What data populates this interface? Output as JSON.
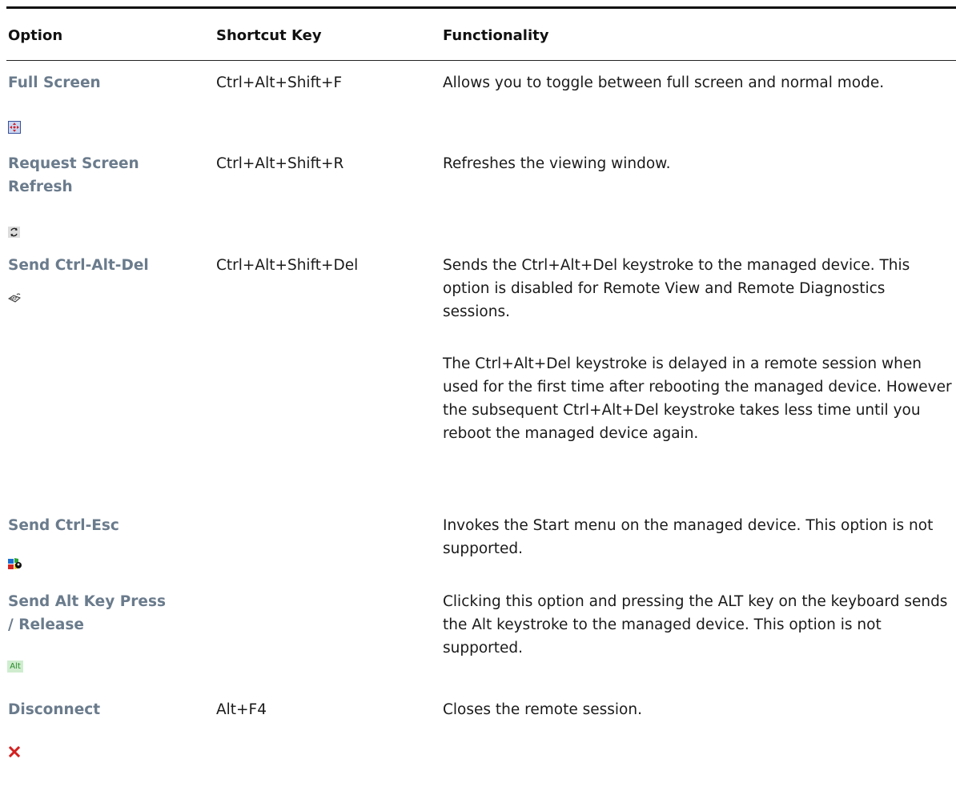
{
  "table": {
    "headers": {
      "option": "Option",
      "shortcut": "Shortcut Key",
      "functionality": "Functionality"
    },
    "rows": [
      {
        "option": "Full Screen",
        "shortcut": "Ctrl+Alt+Shift+F",
        "functionality": [
          "Allows you to toggle between full screen and normal mode."
        ],
        "icon": "full-screen-icon"
      },
      {
        "option": "Request Screen Refresh",
        "shortcut": "Ctrl+Alt+Shift+R",
        "functionality": [
          "Refreshes the viewing window."
        ],
        "icon": "refresh-icon"
      },
      {
        "option": "Send Ctrl-Alt-Del",
        "shortcut": "Ctrl+Alt+Shift+Del",
        "functionality": [
          "Sends the Ctrl+Alt+Del keystroke to the managed device. This option is disabled for Remote View and Remote Diagnostics sessions.",
          "The Ctrl+Alt+Del keystroke is delayed in a remote session when used for the first time after rebooting the managed device. However the subsequent Ctrl+Alt+Del keystroke takes less time until you reboot the managed device again."
        ],
        "icon": "keyboard-icon"
      },
      {
        "option": "Send Ctrl-Esc",
        "shortcut": "",
        "functionality": [
          " Invokes the Start menu on the managed device. This option is not supported."
        ],
        "icon": "windows-flag-icon"
      },
      {
        "option": "Send Alt Key Press / Release",
        "shortcut": "",
        "functionality": [
          "Clicking this option and pressing the ALT key on the keyboard sends the Alt keystroke to the managed device. This option is not supported."
        ],
        "icon": "alt-key-icon",
        "icon_text": "Alt"
      },
      {
        "option": "Disconnect",
        "shortcut": "Alt+F4",
        "functionality": [
          "Closes the remote session."
        ],
        "icon": "close-x-icon"
      }
    ]
  },
  "colors": {
    "option_text": "#6a7b8c",
    "body_text": "#1a1a1a",
    "rule": "#111111",
    "close_icon": "#d42020",
    "alt_icon_bg": "#cfeccf",
    "alt_icon_text": "#2a8a2a"
  }
}
